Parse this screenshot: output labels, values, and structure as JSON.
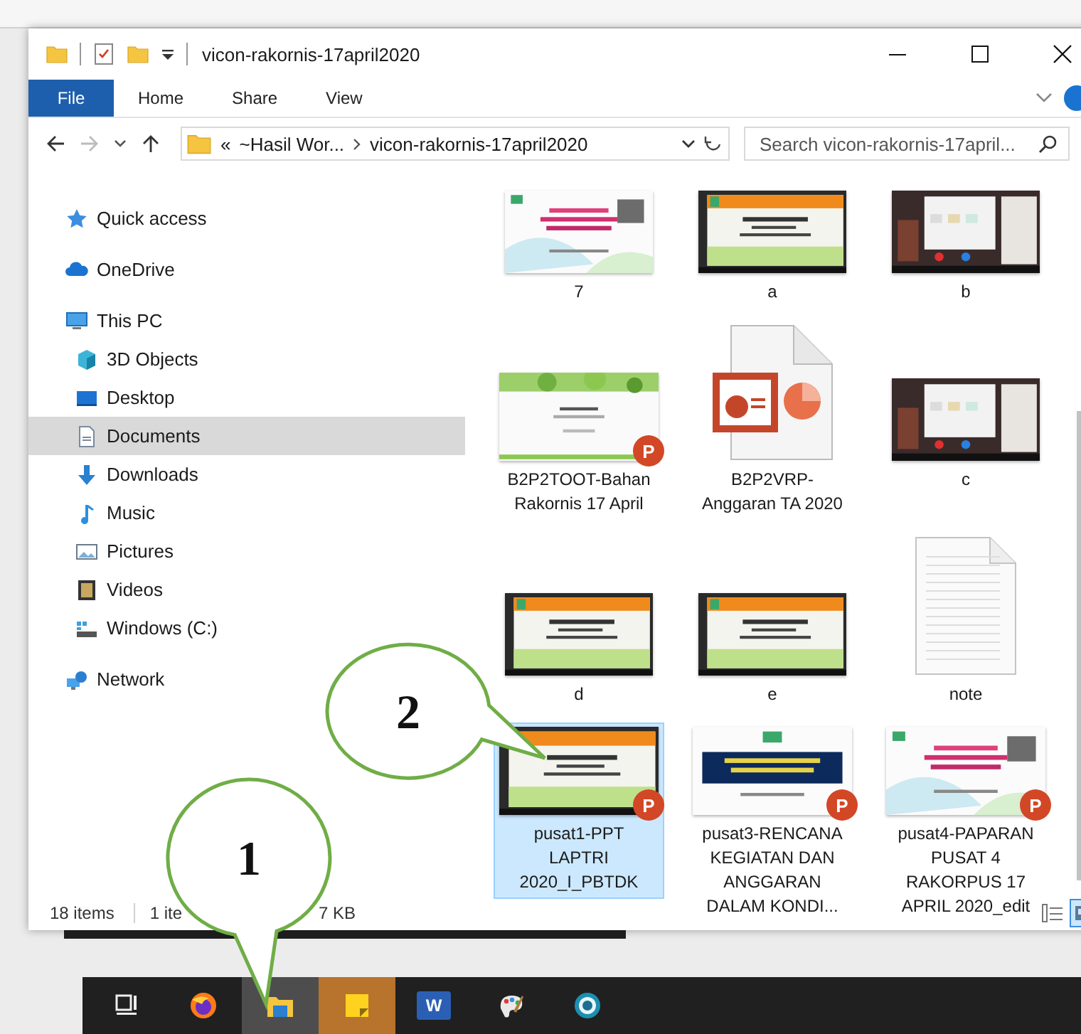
{
  "window": {
    "title": "vicon-rakornis-17april2020"
  },
  "ribbon_tabs": [
    {
      "label": "File",
      "kind": "menu"
    },
    {
      "label": "Home",
      "kind": "tab"
    },
    {
      "label": "Share",
      "kind": "tab"
    },
    {
      "label": "View",
      "kind": "tab"
    }
  ],
  "address_bar": {
    "overflow": "«",
    "segments": [
      "~Hasil Wor...",
      "vicon-rakornis-17april2020"
    ]
  },
  "search": {
    "placeholder": "Search vicon-rakornis-17april..."
  },
  "navigation": [
    {
      "label": "Quick access",
      "selected": false
    },
    {
      "label": "OneDrive",
      "selected": false
    },
    {
      "label": "This PC",
      "selected": false,
      "children": [
        {
          "label": "3D Objects",
          "selected": false
        },
        {
          "label": "Desktop",
          "selected": false
        },
        {
          "label": "Documents",
          "selected": true
        },
        {
          "label": "Downloads",
          "selected": false
        },
        {
          "label": "Music",
          "selected": false
        },
        {
          "label": "Pictures",
          "selected": false
        },
        {
          "label": "Videos",
          "selected": false
        },
        {
          "label": "Windows (C:)",
          "selected": false
        }
      ]
    },
    {
      "label": "Network",
      "selected": false
    }
  ],
  "files": [
    {
      "name": "7",
      "selected": false
    },
    {
      "name": "a",
      "selected": false
    },
    {
      "name": "b",
      "selected": false
    },
    {
      "name": "B2P2TOOT-Bahan Rakornis 17 April",
      "kind": "presentation",
      "badge": "P",
      "selected": false
    },
    {
      "name": "B2P2VRP-Anggaran TA 2020",
      "kind": "ppt-file",
      "selected": false
    },
    {
      "name": "c",
      "selected": false
    },
    {
      "name": "d",
      "selected": false
    },
    {
      "name": "e",
      "selected": false
    },
    {
      "name": "note",
      "kind": "text-file",
      "selected": false
    },
    {
      "name": "pusat1-PPT LAPTRI 2020_I_PBTDK",
      "kind": "presentation",
      "badge": "P",
      "selected": true
    },
    {
      "name": "pusat3-RENCANA KEGIATAN DAN ANGGARAN DALAM KONDI...",
      "kind": "presentation",
      "badge": "P",
      "selected": false
    },
    {
      "name": "pusat4-PAPARAN PUSAT 4 RAKORPUS 17 APRIL 2020_edit",
      "kind": "presentation",
      "badge": "P",
      "selected": false
    }
  ],
  "status_bar": {
    "item_count": "18 items",
    "selection_start": "1 ite",
    "selection_end": "7 KB"
  },
  "view_buttons": [
    {
      "selected": false
    },
    {
      "selected": true
    }
  ],
  "taskbar": [
    {
      "active": false,
      "attention": false
    },
    {
      "active": false,
      "attention": false
    },
    {
      "active": true,
      "attention": false
    },
    {
      "active": false,
      "attention": true
    },
    {
      "active": false,
      "attention": false,
      "letter": "W"
    },
    {
      "active": false,
      "attention": false
    },
    {
      "active": false,
      "attention": false
    }
  ],
  "callouts": [
    {
      "label": "2"
    },
    {
      "label": "1"
    }
  ]
}
